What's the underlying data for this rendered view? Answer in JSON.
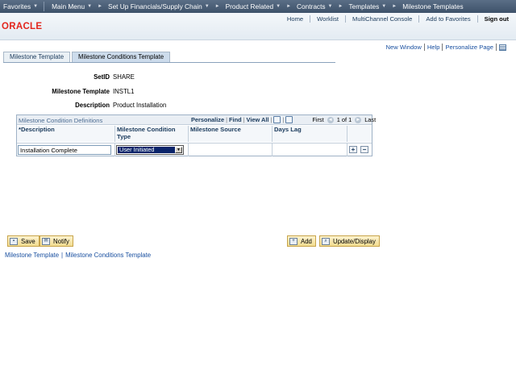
{
  "menubar": {
    "favorites": "Favorites",
    "main_menu": "Main Menu",
    "crumbs": [
      "Set Up Financials/Supply Chain",
      "Product Related",
      "Contracts",
      "Templates",
      "Milestone Templates"
    ]
  },
  "header": {
    "logo": "ORACLE",
    "links": [
      "Home",
      "Worklist",
      "MultiChannel Console",
      "Add to Favorites",
      "Sign out"
    ]
  },
  "page_links": [
    "New Window",
    "Help",
    "Personalize Page"
  ],
  "tabs": [
    "Milestone Template",
    "Milestone Conditions Template"
  ],
  "form": {
    "setid_label": "SetID",
    "setid_value": "SHARE",
    "template_label": "Milestone Template",
    "template_value": "INSTL1",
    "description_label": "Description",
    "description_value": "Product Installation"
  },
  "grid": {
    "title": "Milestone Condition Definitions",
    "personalize": "Personalize",
    "find": "Find",
    "view_all": "View All",
    "first": "First",
    "range": "1 of 1",
    "last": "Last",
    "columns": [
      "*Description",
      "Milestone Condition Type",
      "Milestone Source",
      "Days Lag"
    ],
    "rows": [
      {
        "description": "Installation Complete",
        "condition_type": "User Initiated",
        "source": "",
        "days_lag": ""
      }
    ]
  },
  "buttons": {
    "save": "Save",
    "notify": "Notify",
    "add": "Add",
    "update_display": "Update/Display"
  },
  "bottom_links": [
    "Milestone Template",
    "Milestone Conditions Template"
  ]
}
